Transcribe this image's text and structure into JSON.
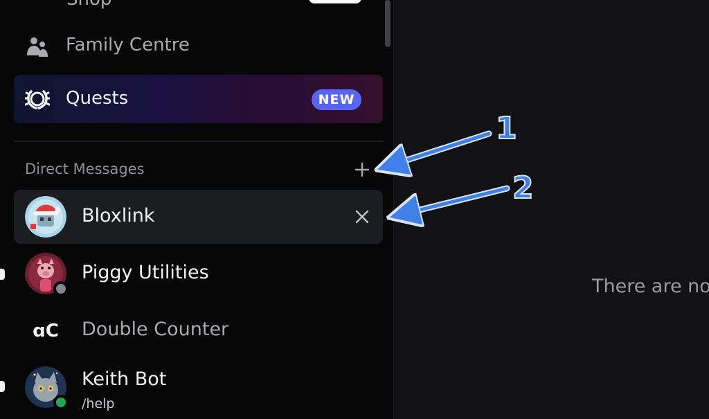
{
  "sidebar": {
    "top_partial_label": "Shop",
    "nav": [
      {
        "label": "Family Centre",
        "icon": "people-icon"
      },
      {
        "label": "Quests",
        "icon": "laurel-icon",
        "badge": "NEW"
      }
    ],
    "dm_section": {
      "header": "Direct Messages",
      "add_icon": "plus-icon"
    },
    "dms": [
      {
        "name": "Bloxlink",
        "selected": true,
        "close_icon": "close-icon"
      },
      {
        "name": "Piggy Utilities",
        "status": "offline"
      },
      {
        "name": "Double Counter",
        "muted": true
      },
      {
        "name": "Keith Bot",
        "subtitle": "/help",
        "status": "online"
      }
    ]
  },
  "main": {
    "empty_text": "There are no f"
  },
  "annotations": [
    {
      "label": "1"
    },
    {
      "label": "2"
    }
  ],
  "colors": {
    "accent": "#5865f2",
    "online": "#23a55a",
    "annotation": "#3f7fe8"
  }
}
